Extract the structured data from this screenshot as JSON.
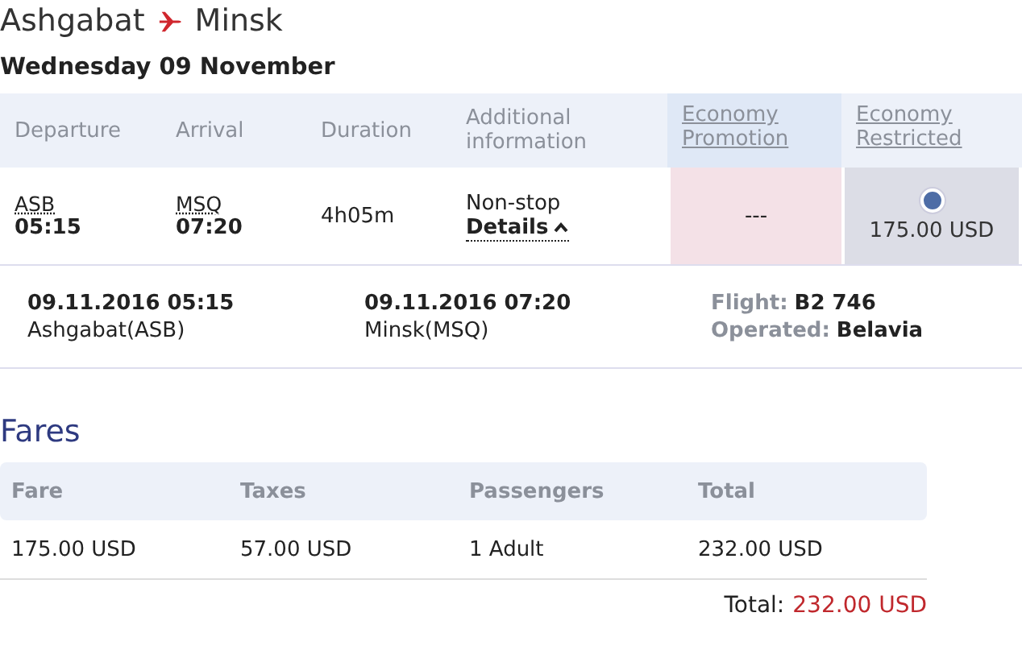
{
  "route": {
    "origin": "Ashgabat",
    "destination": "Minsk"
  },
  "date": "Wednesday 09 November",
  "flights_table": {
    "columns": [
      "Departure",
      "Arrival",
      "Duration",
      "Additional information"
    ],
    "fare_classes": [
      {
        "label": "Economy Promotion",
        "highlighted": true
      },
      {
        "label": "Economy Restricted",
        "highlighted": false
      }
    ],
    "rows": [
      {
        "departure_code": "ASB",
        "departure_time": "05:15",
        "arrival_code": "MSQ",
        "arrival_time": "07:20",
        "duration": "4h05m",
        "stops": "Non-stop",
        "details_link": "Details",
        "expanded": true,
        "fares": [
          {
            "kind": "unavailable",
            "text": "---"
          },
          {
            "kind": "price",
            "text": "175.00 USD",
            "selected": true
          }
        ],
        "details": {
          "departure_datetime": "09.11.2016 05:15",
          "departure_place": "Ashgabat(ASB)",
          "arrival_datetime": "09.11.2016 07:20",
          "arrival_place": "Minsk(MSQ)",
          "info": [
            {
              "label": "Flight:",
              "value": "B2 746"
            },
            {
              "label": "Operated:",
              "value": "Belavia"
            }
          ]
        }
      }
    ]
  },
  "fares": {
    "title": "Fares",
    "columns": [
      "Fare",
      "Taxes",
      "Passengers",
      "Total"
    ],
    "rows": [
      [
        "175.00 USD",
        "57.00 USD",
        "1 Adult",
        "232.00 USD"
      ]
    ],
    "total_label": "Total:",
    "total_value": "232.00 USD"
  }
}
